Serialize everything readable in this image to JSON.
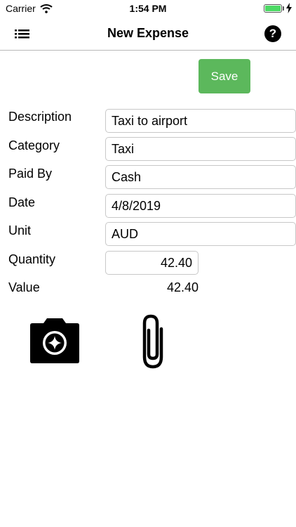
{
  "status_bar": {
    "carrier": "Carrier",
    "time": "1:54 PM",
    "battery_level": 1.0,
    "charging": true,
    "battery_color": "#4cd964"
  },
  "nav": {
    "title": "New Expense",
    "menu_icon": "list-icon",
    "help_icon": "help-circle-icon",
    "help_glyph": "?"
  },
  "save_label": "Save",
  "save_color": "#5cb85c",
  "form": {
    "description": {
      "label": "Description",
      "value": "Taxi to airport"
    },
    "category": {
      "label": "Category",
      "value": "Taxi"
    },
    "paid_by": {
      "label": "Paid By",
      "value": "Cash"
    },
    "date": {
      "label": "Date",
      "value": "4/8/2019"
    },
    "unit": {
      "label": "Unit",
      "value": "AUD"
    },
    "quantity": {
      "label": "Quantity",
      "value": "42.40"
    },
    "value": {
      "label": "Value",
      "value": "42.40"
    }
  },
  "attachments": {
    "camera_icon": "add-photo-camera-icon",
    "attach_icon": "paperclip-icon"
  }
}
